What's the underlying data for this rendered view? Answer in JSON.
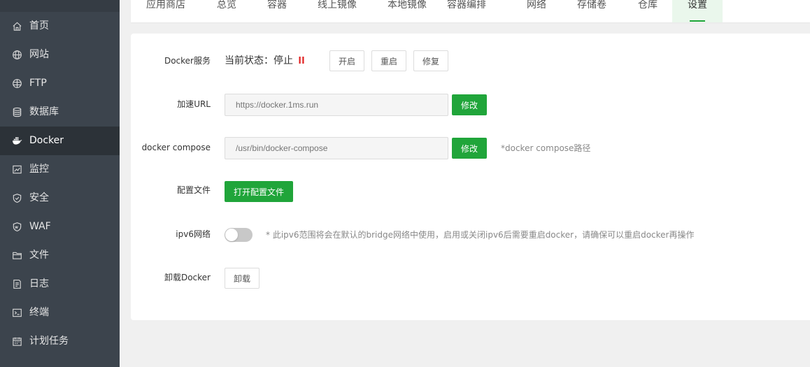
{
  "sidebar": {
    "items": [
      {
        "label": "首页",
        "icon": "home-icon"
      },
      {
        "label": "网站",
        "icon": "globe-icon"
      },
      {
        "label": "FTP",
        "icon": "ftp-globe-icon"
      },
      {
        "label": "数据库",
        "icon": "database-icon"
      },
      {
        "label": "Docker",
        "icon": "docker-whale-icon",
        "active": true
      },
      {
        "label": "监控",
        "icon": "monitor-chart-icon"
      },
      {
        "label": "安全",
        "icon": "shield-icon"
      },
      {
        "label": "WAF",
        "icon": "waf-shield-icon"
      },
      {
        "label": "文件",
        "icon": "folder-icon"
      },
      {
        "label": "日志",
        "icon": "log-icon"
      },
      {
        "label": "终端",
        "icon": "terminal-icon"
      },
      {
        "label": "计划任务",
        "icon": "calendar-icon"
      }
    ]
  },
  "tabs": [
    {
      "label": "应用商店"
    },
    {
      "label": "总览"
    },
    {
      "label": "容器"
    },
    {
      "label": "线上镜像"
    },
    {
      "label": "本地镜像"
    },
    {
      "label": "容器编排"
    },
    {
      "label": "网络"
    },
    {
      "label": "存储卷"
    },
    {
      "label": "仓库"
    },
    {
      "label": "设置",
      "active": true
    }
  ],
  "settings": {
    "docker_service": {
      "label": "Docker服务",
      "status_text": "当前状态：停止",
      "start_label": "开启",
      "restart_label": "重启",
      "repair_label": "修复"
    },
    "mirror_url": {
      "label": "加速URL",
      "placeholder": "https://docker.1ms.run",
      "modify_label": "修改"
    },
    "compose": {
      "label": "docker compose",
      "placeholder": "/usr/bin/docker-compose",
      "modify_label": "修改",
      "hint": "*docker compose路径"
    },
    "config_file": {
      "label": "配置文件",
      "open_label": "打开配置文件"
    },
    "ipv6": {
      "label": "ipv6网络",
      "enabled": false,
      "hint": "* 此ipv6范围将会在默认的bridge网络中使用，启用或关闭ipv6后需要重启docker，请确保可以重启docker再操作"
    },
    "uninstall": {
      "label": "卸载Docker",
      "button_label": "卸载"
    }
  },
  "colors": {
    "accent": "#20a53a",
    "sidebar_bg": "#3c444d",
    "sidebar_active_bg": "#2c3238",
    "status_stopped": "#e02020"
  }
}
